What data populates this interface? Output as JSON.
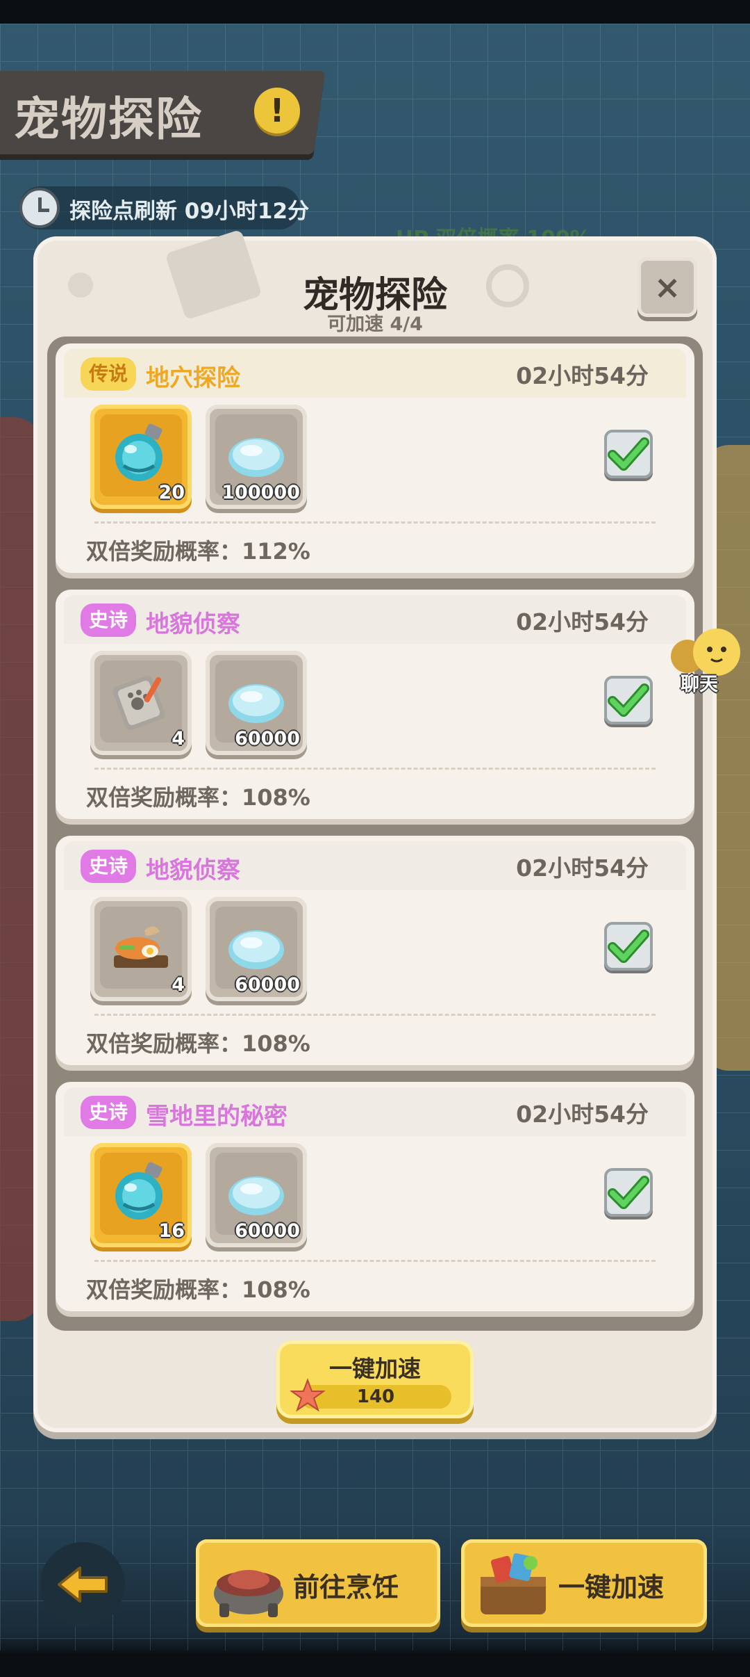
{
  "header": {
    "title": "宠物探险",
    "refresh_text": "探险点刷新  09小时12分",
    "behind_text": "HP 双倍概率 100%"
  },
  "modal": {
    "title": "宠物探险",
    "subtitle": "可加速 4/4",
    "close_label": "×"
  },
  "expeditions": [
    {
      "rarity": "传说",
      "name": "地穴探险",
      "time": "02小时54分",
      "item1_qty": "20",
      "item2_qty": "100000",
      "rate": "双倍奖励概率：112%"
    },
    {
      "rarity": "史诗",
      "name": "地貌侦察",
      "time": "02小时54分",
      "item1_qty": "4",
      "item2_qty": "60000",
      "rate": "双倍奖励概率：108%"
    },
    {
      "rarity": "史诗",
      "name": "地貌侦察",
      "time": "02小时54分",
      "item1_qty": "4",
      "item2_qty": "60000",
      "rate": "双倍奖励概率：108%"
    },
    {
      "rarity": "史诗",
      "name": "雪地里的秘密",
      "time": "02小时54分",
      "item1_qty": "16",
      "item2_qty": "60000",
      "rate": "双倍奖励概率：108%"
    }
  ],
  "speedup": {
    "label": "一键加速",
    "cost": "140"
  },
  "chat": {
    "label": "聊天"
  },
  "bottom": {
    "cook_label": "前往烹饪",
    "speedup_label": "一键加速"
  },
  "colors": {
    "legend": "#efa823",
    "epic": "#d876dc",
    "button": "#f9dc5b"
  }
}
